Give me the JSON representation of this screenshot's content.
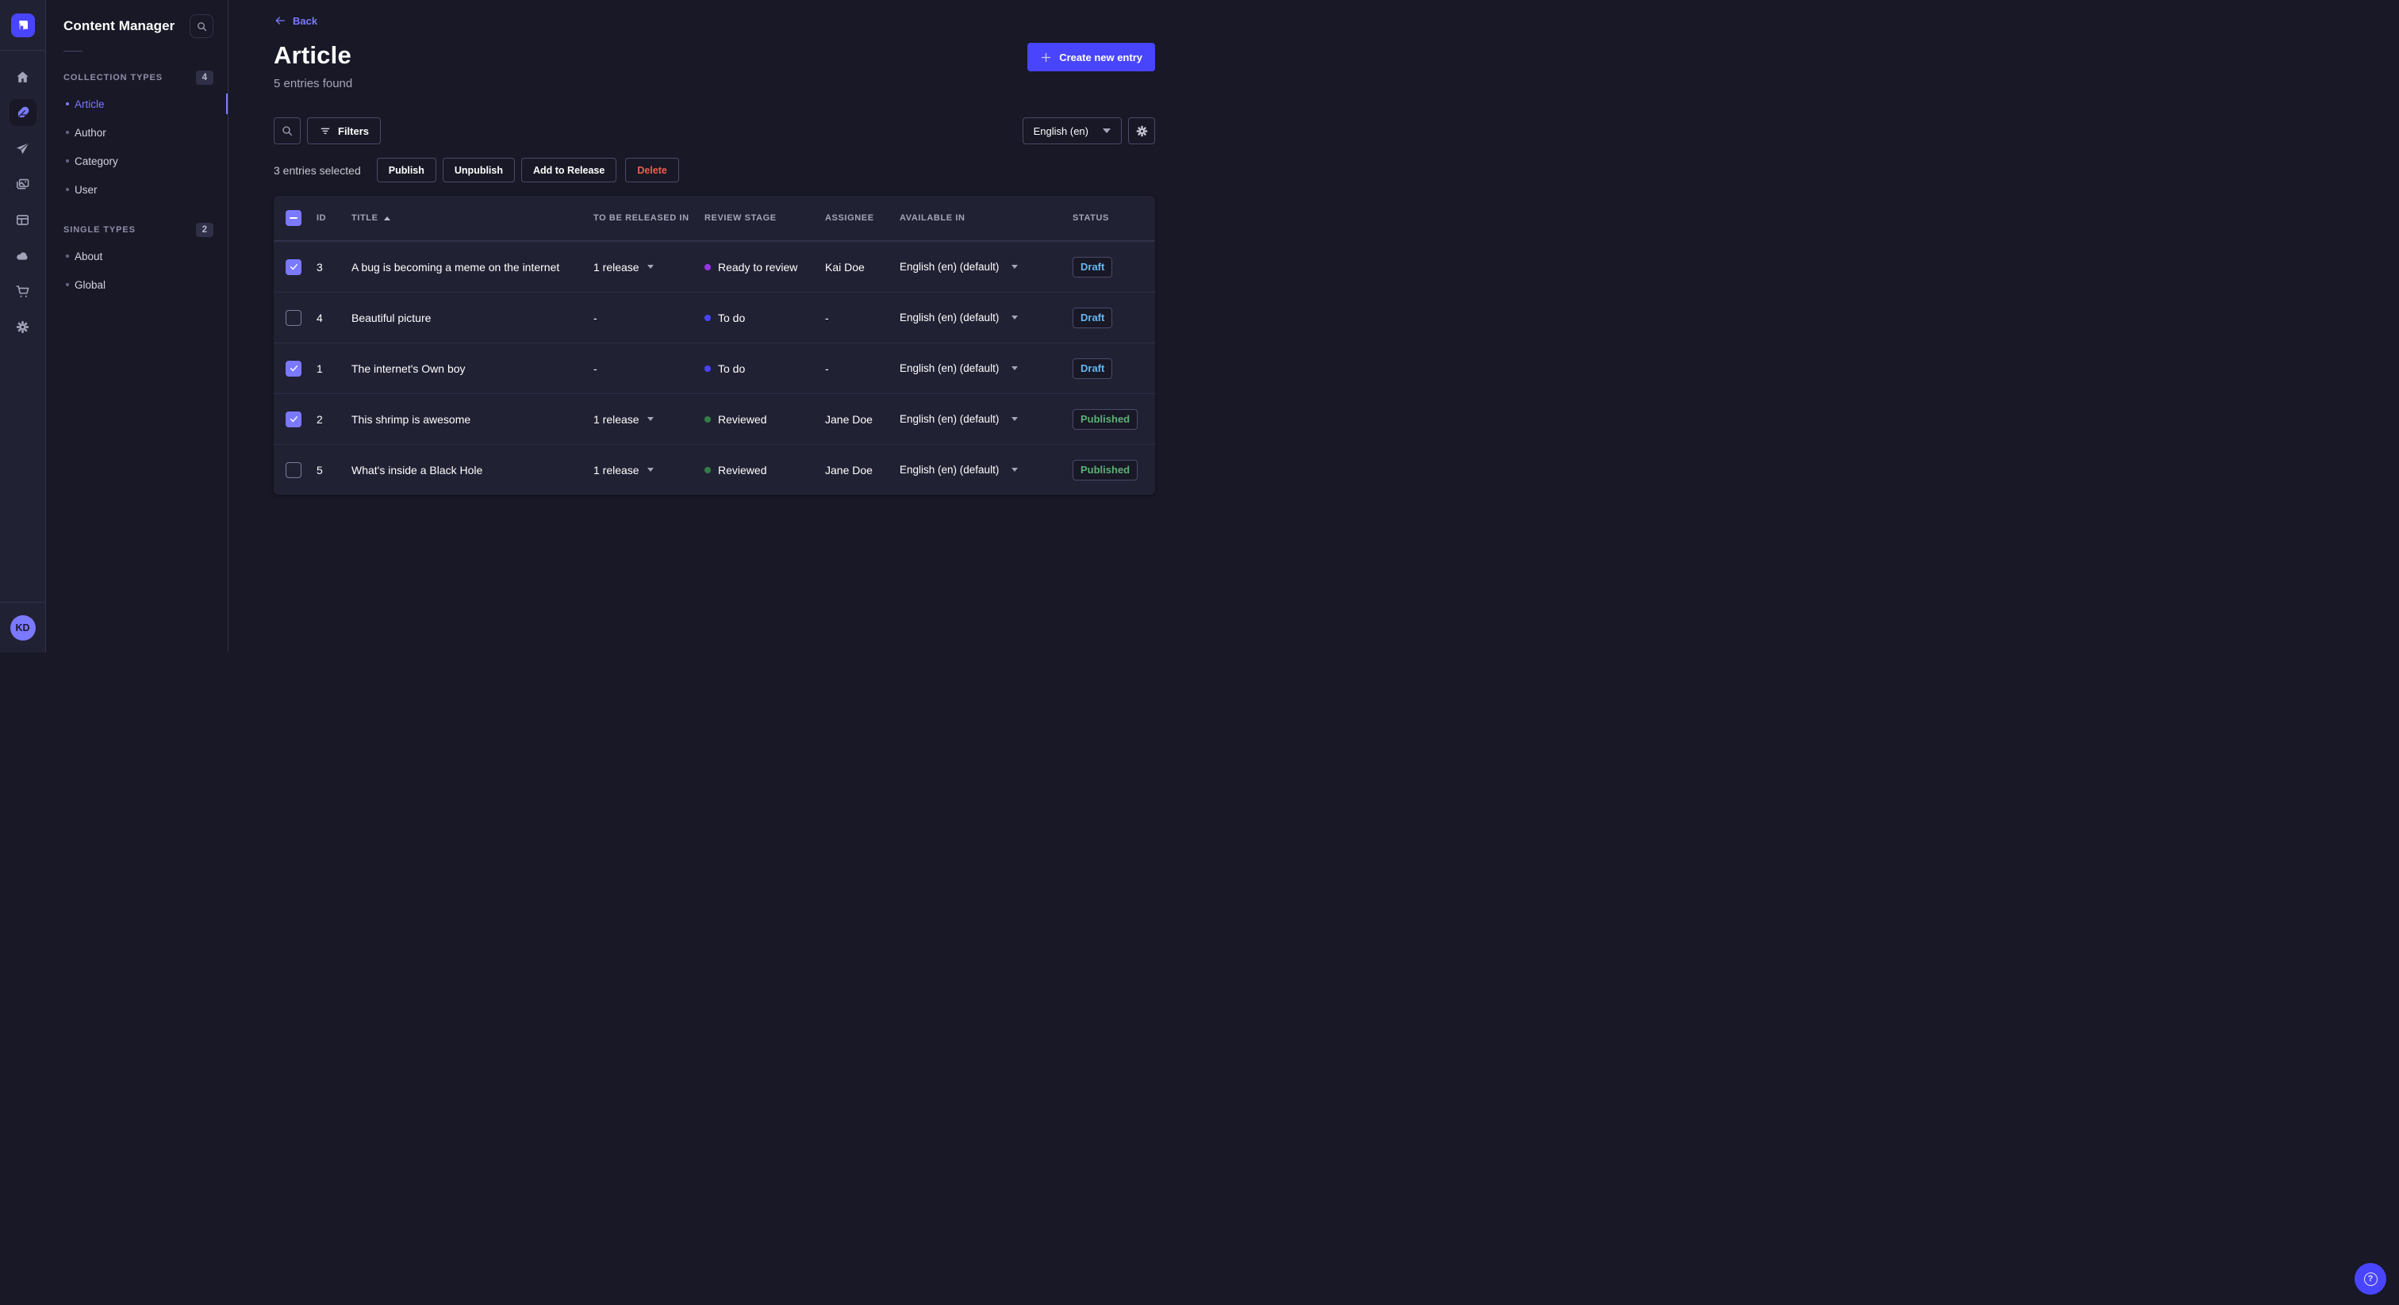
{
  "sidebar": {
    "title": "Content Manager",
    "sections": [
      {
        "label": "COLLECTION TYPES",
        "badge": "4",
        "items": [
          {
            "label": "Article",
            "active": true
          },
          {
            "label": "Author",
            "active": false
          },
          {
            "label": "Category",
            "active": false
          },
          {
            "label": "User",
            "active": false
          }
        ]
      },
      {
        "label": "SINGLE TYPES",
        "badge": "2",
        "items": [
          {
            "label": "About",
            "active": false
          },
          {
            "label": "Global",
            "active": false
          }
        ]
      }
    ]
  },
  "rail": {
    "avatar_initials": "KD"
  },
  "header": {
    "back_label": "Back",
    "title": "Article",
    "subtitle": "5 entries found",
    "create_label": "Create new entry"
  },
  "toolbar": {
    "filters_label": "Filters",
    "locale_value": "English (en)"
  },
  "selection": {
    "text": "3 entries selected",
    "publish_label": "Publish",
    "unpublish_label": "Unpublish",
    "add_to_release_label": "Add to Release",
    "delete_label": "Delete"
  },
  "table": {
    "headers": {
      "id": "ID",
      "title": "TITLE",
      "release": "TO BE RELEASED IN",
      "stage": "REVIEW STAGE",
      "assignee": "ASSIGNEE",
      "available": "AVAILABLE IN",
      "status": "STATUS"
    },
    "header_checkbox_state": "indeterminate",
    "rows": [
      {
        "selected": true,
        "id": "3",
        "title": "A bug is becoming a meme on the internet",
        "release": "1 release",
        "stage": "Ready to review",
        "stage_color": "#9736e8",
        "assignee": "Kai Doe",
        "locale": "English (en) (default)",
        "status": "Draft",
        "status_color": "#66b7f1"
      },
      {
        "selected": false,
        "id": "4",
        "title": "Beautiful picture",
        "release": "-",
        "stage": "To do",
        "stage_color": "#4945ff",
        "assignee": "-",
        "locale": "English (en) (default)",
        "status": "Draft",
        "status_color": "#66b7f1"
      },
      {
        "selected": true,
        "id": "1",
        "title": "The internet's Own boy",
        "release": "-",
        "stage": "To do",
        "stage_color": "#4945ff",
        "assignee": "-",
        "locale": "English (en) (default)",
        "status": "Draft",
        "status_color": "#66b7f1"
      },
      {
        "selected": true,
        "id": "2",
        "title": "This shrimp is awesome",
        "release": "1 release",
        "stage": "Reviewed",
        "stage_color": "#328048",
        "assignee": "Jane Doe",
        "locale": "English (en) (default)",
        "status": "Published",
        "status_color": "#5cb176"
      },
      {
        "selected": false,
        "id": "5",
        "title": "What's inside a Black Hole",
        "release": "1 release",
        "stage": "Reviewed",
        "stage_color": "#328048",
        "assignee": "Jane Doe",
        "locale": "English (en) (default)",
        "status": "Published",
        "status_color": "#5cb176"
      }
    ]
  },
  "colors": {
    "primary": "#4945ff",
    "primary_light": "#7b79ff",
    "success": "#5cb176",
    "danger": "#ee5e52",
    "draft_blue": "#66b7f1"
  }
}
